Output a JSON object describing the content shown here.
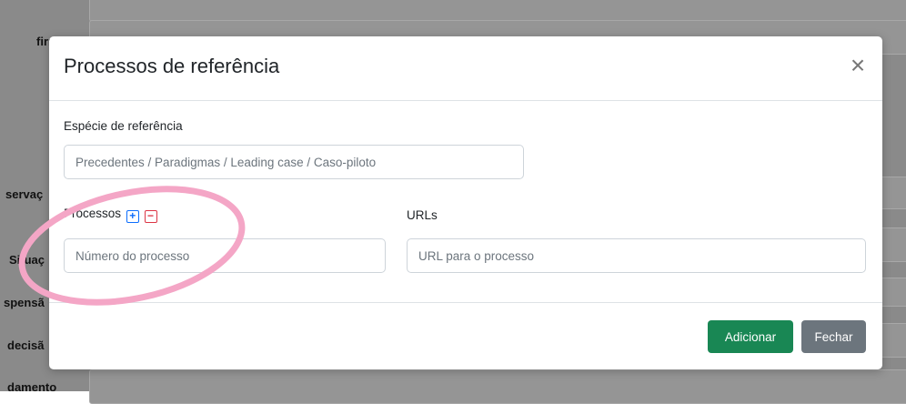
{
  "background": {
    "labels": [
      "firma",
      "servaç",
      "Situaç",
      "spensã",
      "decisã",
      "damento"
    ]
  },
  "modal": {
    "title": "Processos de referência",
    "close_symbol": "×",
    "especie": {
      "label": "Espécie de referência",
      "placeholder": "Precedentes / Paradigmas / Leading case / Caso-piloto"
    },
    "processos": {
      "label": "Processos",
      "add_symbol": "+",
      "remove_symbol": "−",
      "placeholder": "Número do processo"
    },
    "urls": {
      "label": "URLs",
      "placeholder": "URL para o processo"
    },
    "footer": {
      "add_label": "Adicionar",
      "close_label": "Fechar"
    }
  },
  "colors": {
    "success": "#198754",
    "secondary": "#6c757d",
    "annotation": "#f4a6c6"
  }
}
